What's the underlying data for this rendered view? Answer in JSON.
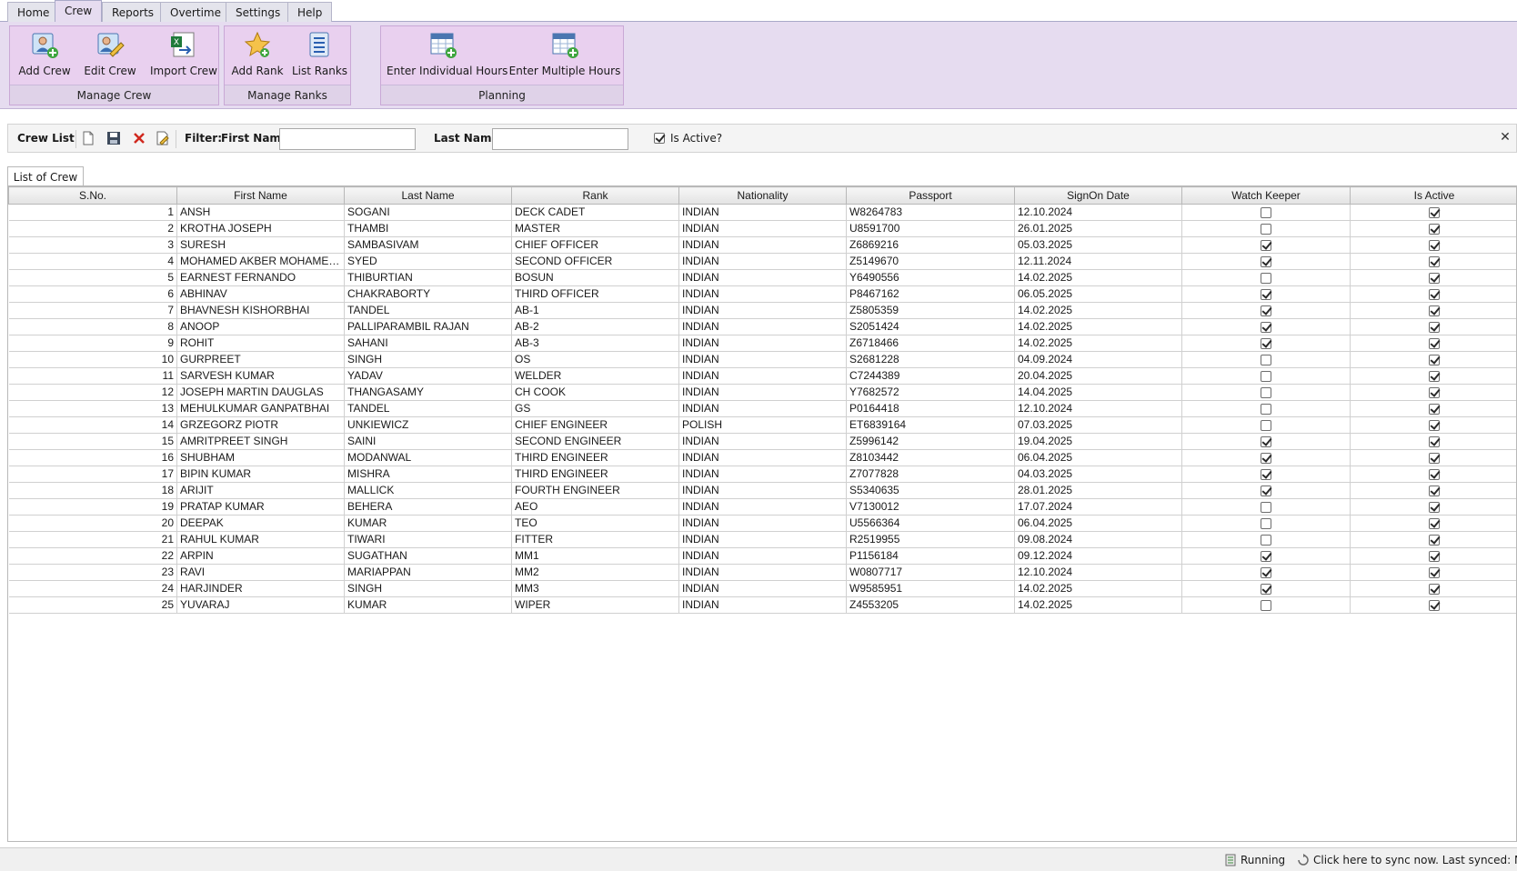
{
  "tabs": [
    "Home",
    "Crew",
    "Reports",
    "Overtime",
    "Settings",
    "Help"
  ],
  "ribbon": {
    "manage_crew": {
      "caption": "Manage Crew",
      "add": "Add Crew",
      "edit": "Edit Crew",
      "import": "Import Crew"
    },
    "manage_ranks": {
      "caption": "Manage Ranks",
      "add": "Add Rank",
      "list": "List Ranks"
    },
    "planning": {
      "caption": "Planning",
      "individual": "Enter Individual Hours",
      "multiple": "Enter Multiple Hours"
    }
  },
  "filterbar": {
    "title": "Crew List",
    "filter_label": "Filter:",
    "first_name_label": "First Name",
    "first_name_value": "",
    "last_name_label": "Last Name",
    "last_name_value": "",
    "is_active_label": "Is Active?",
    "is_active_checked": true
  },
  "grid_tab": "List of Crew",
  "columns": [
    "S.No.",
    "First Name",
    "Last Name",
    "Rank",
    "Nationality",
    "Passport",
    "SignOn Date",
    "Watch Keeper",
    "Is Active"
  ],
  "rows": [
    {
      "sno": "1",
      "first": "ANSH",
      "last": "SOGANI",
      "rank": "DECK CADET",
      "nat": "INDIAN",
      "passport": "W8264783",
      "date": "12.10.2024",
      "watch": false,
      "active": true
    },
    {
      "sno": "2",
      "first": "KROTHA JOSEPH",
      "last": "THAMBI",
      "rank": "MASTER",
      "nat": "INDIAN",
      "passport": "U8591700",
      "date": "26.01.2025",
      "watch": false,
      "active": true
    },
    {
      "sno": "3",
      "first": "SURESH",
      "last": "SAMBASIVAM",
      "rank": "CHIEF OFFICER",
      "nat": "INDIAN",
      "passport": "Z6869216",
      "date": "05.03.2025",
      "watch": true,
      "active": true
    },
    {
      "sno": "4",
      "first": "MOHAMED AKBER MOHAMED AQ...",
      "last": "SYED",
      "rank": "SECOND OFFICER",
      "nat": "INDIAN",
      "passport": "Z5149670",
      "date": "12.11.2024",
      "watch": true,
      "active": true
    },
    {
      "sno": "5",
      "first": "EARNEST FERNANDO",
      "last": "THIBURTIAN",
      "rank": "BOSUN",
      "nat": "INDIAN",
      "passport": "Y6490556",
      "date": "14.02.2025",
      "watch": false,
      "active": true
    },
    {
      "sno": "6",
      "first": "ABHINAV",
      "last": "CHAKRABORTY",
      "rank": "THIRD OFFICER",
      "nat": "INDIAN",
      "passport": "P8467162",
      "date": "06.05.2025",
      "watch": true,
      "active": true
    },
    {
      "sno": "7",
      "first": "BHAVNESH KISHORBHAI",
      "last": "TANDEL",
      "rank": "AB-1",
      "nat": "INDIAN",
      "passport": "Z5805359",
      "date": "14.02.2025",
      "watch": true,
      "active": true
    },
    {
      "sno": "8",
      "first": "ANOOP",
      "last": "PALLIPARAMBIL RAJAN",
      "rank": "AB-2",
      "nat": "INDIAN",
      "passport": "S2051424",
      "date": "14.02.2025",
      "watch": true,
      "active": true
    },
    {
      "sno": "9",
      "first": "ROHIT",
      "last": "SAHANI",
      "rank": "AB-3",
      "nat": "INDIAN",
      "passport": "Z6718466",
      "date": "14.02.2025",
      "watch": true,
      "active": true
    },
    {
      "sno": "10",
      "first": "GURPREET",
      "last": "SINGH",
      "rank": "OS",
      "nat": "INDIAN",
      "passport": "S2681228",
      "date": "04.09.2024",
      "watch": false,
      "active": true
    },
    {
      "sno": "11",
      "first": "SARVESH KUMAR",
      "last": "YADAV",
      "rank": "WELDER",
      "nat": "INDIAN",
      "passport": "C7244389",
      "date": "20.04.2025",
      "watch": false,
      "active": true
    },
    {
      "sno": "12",
      "first": "JOSEPH MARTIN DAUGLAS",
      "last": "THANGASAMY",
      "rank": "CH COOK",
      "nat": "INDIAN",
      "passport": "Y7682572",
      "date": "14.04.2025",
      "watch": false,
      "active": true
    },
    {
      "sno": "13",
      "first": "MEHULKUMAR GANPATBHAI",
      "last": "TANDEL",
      "rank": "GS",
      "nat": "INDIAN",
      "passport": "P0164418",
      "date": "12.10.2024",
      "watch": false,
      "active": true
    },
    {
      "sno": "14",
      "first": "GRZEGORZ PIOTR",
      "last": "UNKIEWICZ",
      "rank": "CHIEF ENGINEER",
      "nat": "POLISH",
      "passport": "ET6839164",
      "date": "07.03.2025",
      "watch": false,
      "active": true
    },
    {
      "sno": "15",
      "first": "AMRITPREET SINGH",
      "last": "SAINI",
      "rank": "SECOND ENGINEER",
      "nat": "INDIAN",
      "passport": "Z5996142",
      "date": "19.04.2025",
      "watch": true,
      "active": true
    },
    {
      "sno": "16",
      "first": "SHUBHAM",
      "last": "MODANWAL",
      "rank": "THIRD ENGINEER",
      "nat": "INDIAN",
      "passport": "Z8103442",
      "date": "06.04.2025",
      "watch": true,
      "active": true
    },
    {
      "sno": "17",
      "first": "BIPIN KUMAR",
      "last": "MISHRA",
      "rank": "THIRD ENGINEER",
      "nat": "INDIAN",
      "passport": "Z7077828",
      "date": "04.03.2025",
      "watch": true,
      "active": true
    },
    {
      "sno": "18",
      "first": "ARIJIT",
      "last": "MALLICK",
      "rank": "FOURTH ENGINEER",
      "nat": "INDIAN",
      "passport": "S5340635",
      "date": "28.01.2025",
      "watch": true,
      "active": true
    },
    {
      "sno": "19",
      "first": "PRATAP KUMAR",
      "last": "BEHERA",
      "rank": "AEO",
      "nat": "INDIAN",
      "passport": "V7130012",
      "date": "17.07.2024",
      "watch": false,
      "active": true
    },
    {
      "sno": "20",
      "first": "DEEPAK",
      "last": "KUMAR",
      "rank": "TEO",
      "nat": "INDIAN",
      "passport": "U5566364",
      "date": "06.04.2025",
      "watch": false,
      "active": true
    },
    {
      "sno": "21",
      "first": "RAHUL KUMAR",
      "last": "TIWARI",
      "rank": "FITTER",
      "nat": "INDIAN",
      "passport": "R2519955",
      "date": "09.08.2024",
      "watch": false,
      "active": true
    },
    {
      "sno": "22",
      "first": "ARPIN",
      "last": "SUGATHAN",
      "rank": "MM1",
      "nat": "INDIAN",
      "passport": "P1156184",
      "date": "09.12.2024",
      "watch": true,
      "active": true
    },
    {
      "sno": "23",
      "first": "RAVI",
      "last": "MARIAPPAN",
      "rank": "MM2",
      "nat": "INDIAN",
      "passport": "W0807717",
      "date": "12.10.2024",
      "watch": true,
      "active": true
    },
    {
      "sno": "24",
      "first": "HARJINDER",
      "last": "SINGH",
      "rank": "MM3",
      "nat": "INDIAN",
      "passport": "W9585951",
      "date": "14.02.2025",
      "watch": true,
      "active": true
    },
    {
      "sno": "25",
      "first": "YUVARAJ",
      "last": "KUMAR",
      "rank": "WIPER",
      "nat": "INDIAN",
      "passport": "Z4553205",
      "date": "14.02.2025",
      "watch": false,
      "active": true
    }
  ],
  "status": {
    "running": "Running",
    "sync": "Click here to sync now. Last synced: Never"
  },
  "icons": {
    "add_crew": "add-user-icon",
    "edit_crew": "edit-user-icon",
    "import_crew": "import-excel-icon",
    "add_rank": "star-icon",
    "list_ranks": "list-icon",
    "enter_hours": "calendar-add-icon"
  }
}
